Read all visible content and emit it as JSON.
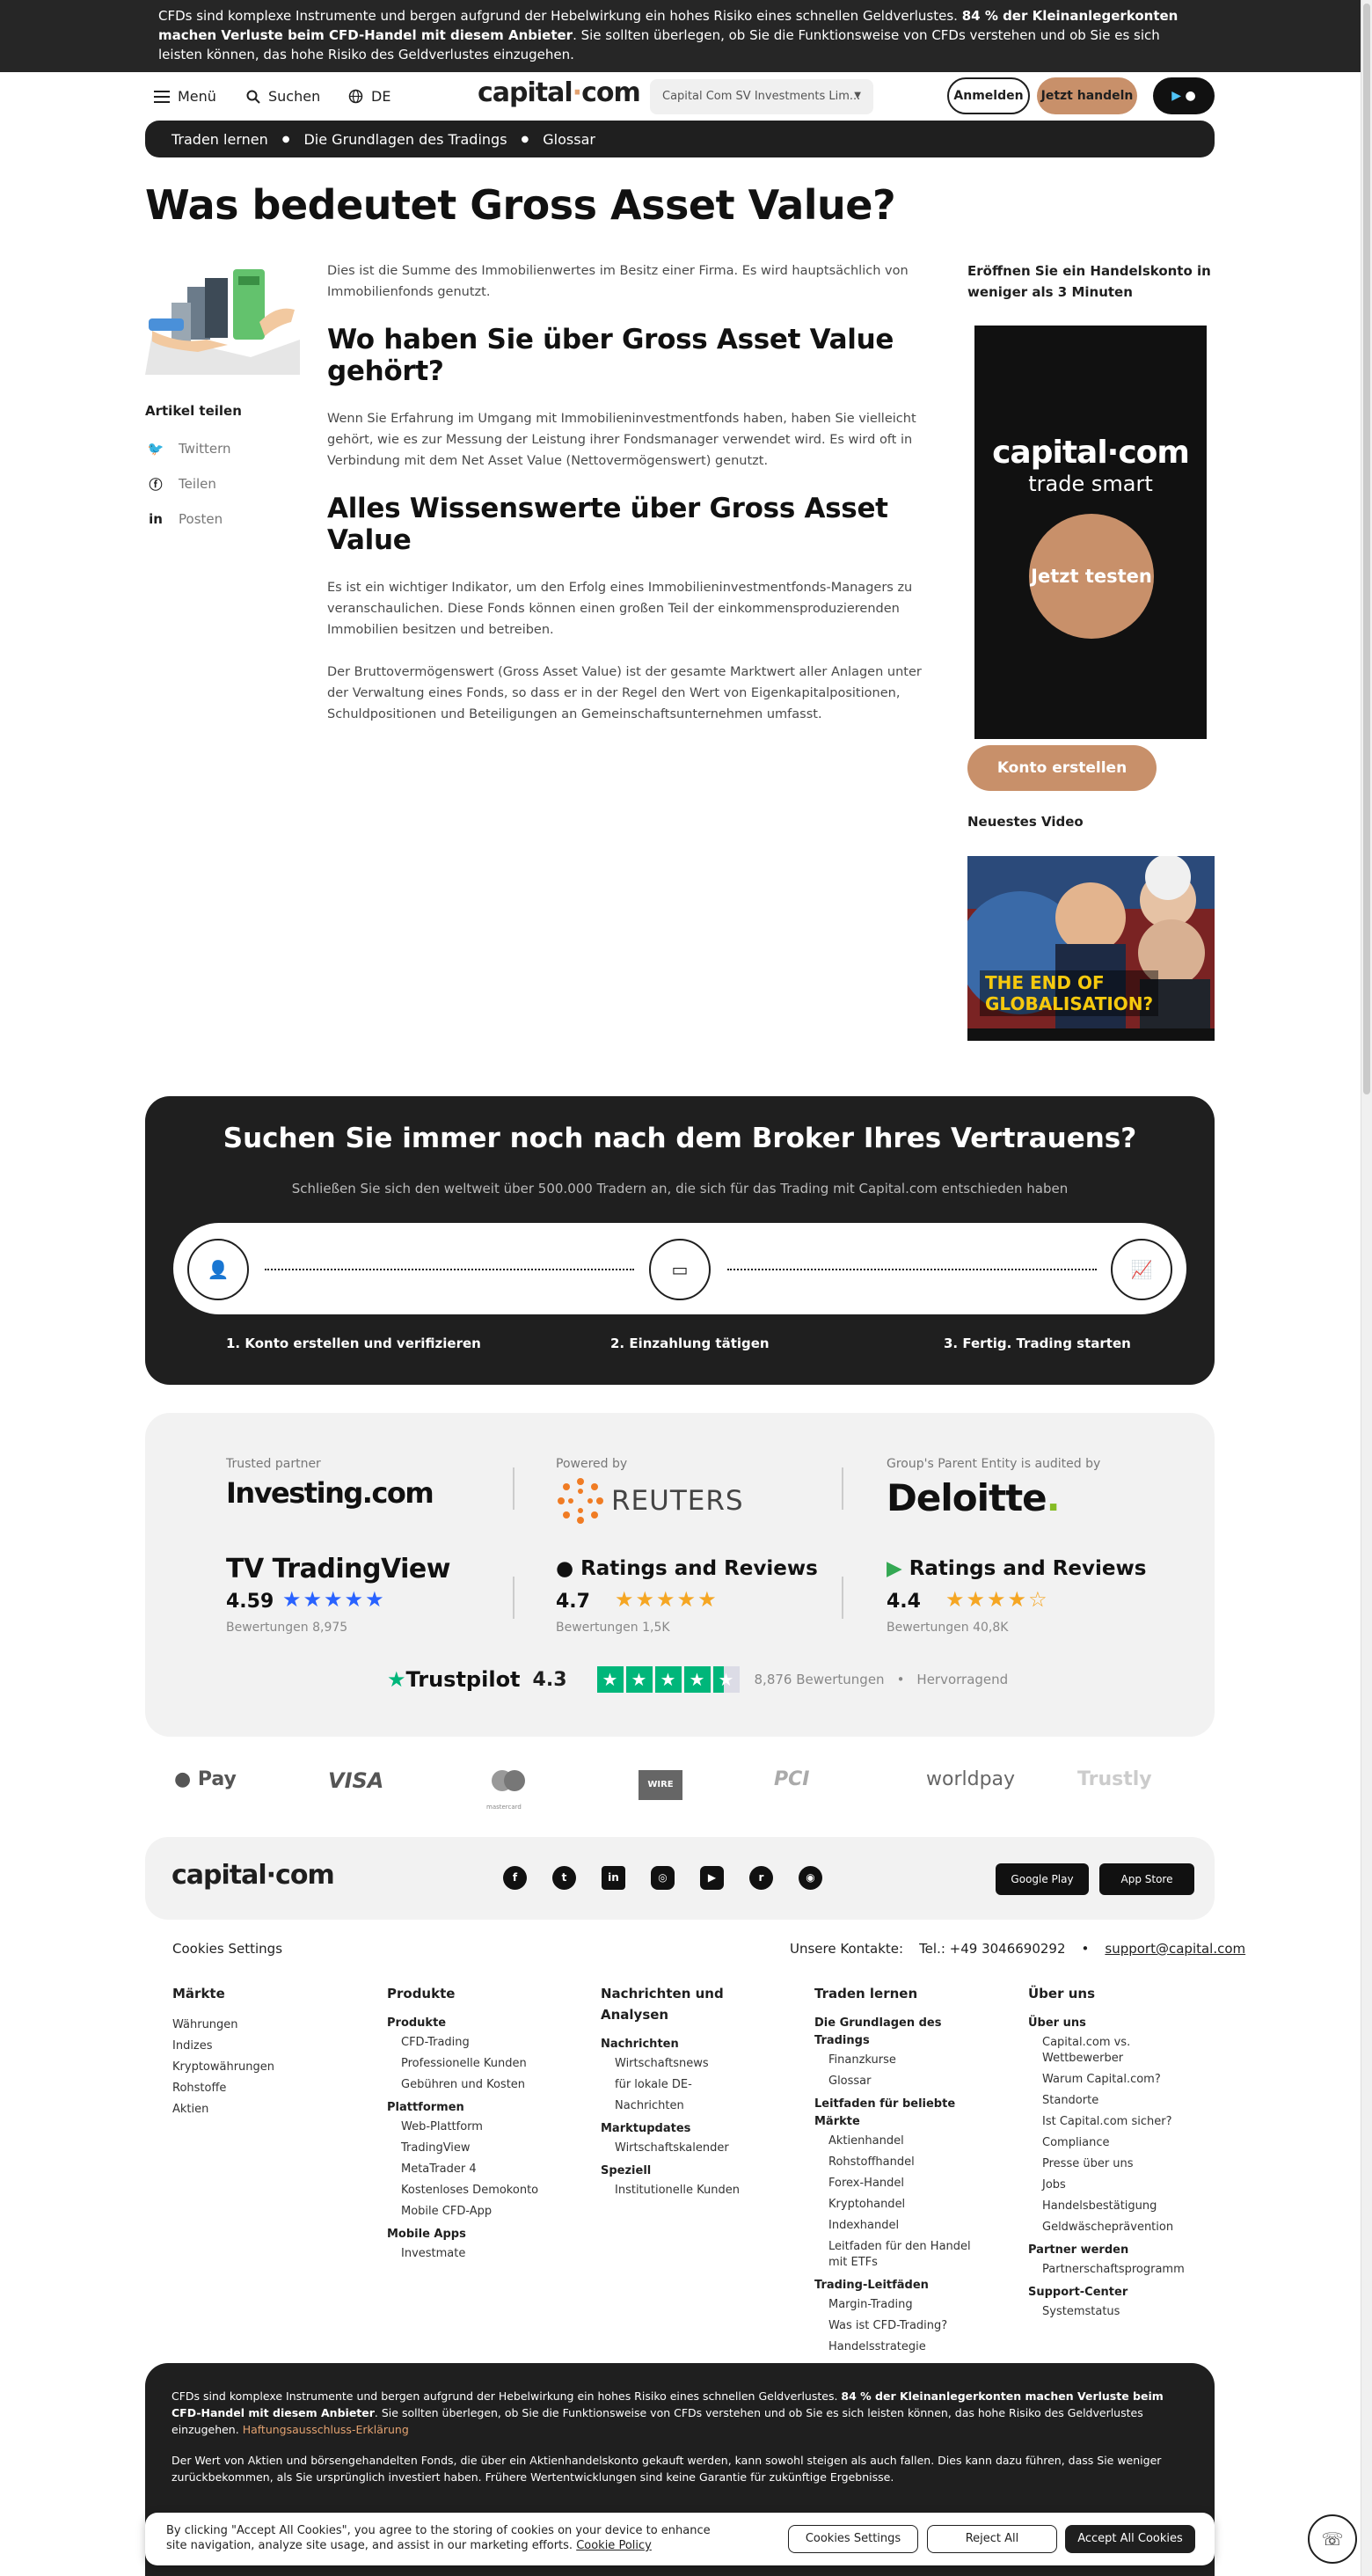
{
  "risk_banner": {
    "text_a": "CFDs sind komplexe Instrumente und bergen aufgrund der Hebelwirkung ein hohes Risiko eines schnellen Geldverlustes. ",
    "text_bold": "84 % der Kleinanlegerkonten machen Verluste beim CFD-Handel mit diesem Anbieter",
    "text_b": ". Sie sollten überlegen, ob Sie die Funktionsweise von CFDs verstehen und ob Sie es sich leisten können, das hohe Risiko des Geldverlustes einzugehen."
  },
  "header": {
    "menu": "Menü",
    "search": "Suchen",
    "lang": "DE",
    "logo": "capital",
    "logo_dot": "·",
    "logo_end": "com",
    "entity": "Capital Com SV Investments Lim...",
    "login": "Anmelden",
    "trade": "Jetzt handeln"
  },
  "breadcrumb": [
    "Traden lernen",
    "Die Grundlagen des Tradings",
    "Glossar"
  ],
  "page_title": "Was bedeutet Gross Asset Value?",
  "share": {
    "title": "Artikel teilen",
    "items": [
      "Twittern",
      "Teilen",
      "Posten"
    ]
  },
  "article": {
    "p1": "Dies ist die Summe des Immobilienwertes im Besitz einer Firma. Es wird hauptsächlich von Immobilienfonds genutzt.",
    "h2a": "Wo haben Sie über Gross Asset Value gehört?",
    "p2": "Wenn Sie Erfahrung im Umgang mit Immobilieninvestmentfonds haben, haben Sie vielleicht gehört, wie es zur Messung der Leistung ihrer Fondsmanager verwendet wird. Es wird oft in Verbindung mit dem Net Asset Value (Nettovermögenswert) genutzt.",
    "h2b": "Alles Wissenswerte über Gross Asset Value",
    "p3": "Es ist ein wichtiger Indikator, um den Erfolg eines Immobilieninvestmentfonds-Managers zu veranschaulichen. Diese Fonds können einen großen Teil der einkommensproduzierenden Immobilien besitzen und betreiben.",
    "p4": "Der Bruttovermögenswert (Gross Asset Value) ist der gesamte Marktwert aller Anlagen unter der Verwaltung eines Fonds, so dass er in der Regel den Wert von Eigenkapitalpositionen, Schuldpositionen und Beteiligungen an Gemeinschaftsunternehmen umfasst."
  },
  "sidebar": {
    "promo": "Eröffnen Sie ein Handelskonto in weniger als 3 Minuten",
    "ad_logo": "capital·com",
    "ad_tagline": "trade smart",
    "ad_cta": "Jetzt testen",
    "konto": "Konto erstellen",
    "video_title": "Neuestes Video",
    "video_caption_1": "THE END OF",
    "video_caption_2": "GLOBALISATION?"
  },
  "broker": {
    "title": "Suchen Sie immer noch nach dem Broker Ihres Vertrauens?",
    "subtitle": "Schließen Sie sich den weltweit über 500.000 Tradern an, die sich für das Trading mit Capital.com entschieden haben",
    "steps": [
      "1. Konto erstellen und verifizieren",
      "2. Einzahlung tätigen",
      "3. Fertig. Trading starten"
    ]
  },
  "trust": {
    "partner_cap": "Trusted partner",
    "partner": "Investing.com",
    "powered_cap": "Powered by",
    "powered": "REUTERS",
    "audit_cap": "Group's Parent Entity is audited by",
    "audit": "Deloitte",
    "tv_name": "TradingView",
    "tv_score": "4.59",
    "tv_count": "Bewertungen 8,975",
    "apple_name": "Ratings and Reviews",
    "apple_score": "4.7",
    "apple_count": "Bewertungen 1,5K",
    "google_name": "Ratings and Reviews",
    "google_score": "4.4",
    "google_count": "Bewertungen 40,8K",
    "tp_name": "Trustpilot",
    "tp_score": "4.3",
    "tp_count": "8,876 Bewertungen",
    "tp_label": "Hervorragend"
  },
  "payments": [
    "Pay",
    "VISA",
    "mastercard",
    "WIRE",
    "PCI",
    "worldpay",
    "Trustly"
  ],
  "footer": {
    "logo": "capital·com",
    "google_play": "Google Play",
    "app_store": "App Store",
    "cookie_settings": "Cookies Settings",
    "contacts_label": "Unsere Kontakte:",
    "phone": "Tel.: +49 3046690292",
    "email": "support@capital.com",
    "cols": {
      "maerkte": {
        "title": "Märkte",
        "items": [
          "Währungen",
          "Indizes",
          "Kryptowährungen",
          "Rohstoffe",
          "Aktien"
        ]
      },
      "produkte": {
        "title": "Produkte",
        "g1": "Produkte",
        "g1_items": [
          "CFD-Trading",
          "Professionelle Kunden",
          "Gebühren und Kosten"
        ],
        "g2": "Plattformen",
        "g2_items": [
          "Web-Plattform",
          "TradingView",
          "MetaTrader 4",
          "Kostenloses Demokonto",
          "Mobile CFD-App"
        ],
        "g3": "Mobile Apps",
        "g3_items": [
          "Investmate"
        ]
      },
      "news": {
        "title": "Nachrichten und Analysen",
        "g1": "Nachrichten",
        "g1_items": [
          "Wirtschaftsnews",
          "für lokale DE-Nachrichten"
        ],
        "g2": "Marktupdates",
        "g2_items": [
          "Wirtschaftskalender"
        ],
        "g3": "Speziell",
        "g3_items": [
          "Institutionelle Kunden"
        ]
      },
      "lernen": {
        "title": "Traden lernen",
        "g1": "Die Grundlagen des Tradings",
        "g1_items": [
          "Finanzkurse",
          "Glossar"
        ],
        "g2": "Leitfaden für beliebte Märkte",
        "g2_items": [
          "Aktienhandel",
          "Rohstoffhandel",
          "Forex-Handel",
          "Kryptohandel",
          "Indexhandel",
          "Leitfaden für den Handel mit ETFs"
        ],
        "g3": "Trading-Leitfäden",
        "g3_items": [
          "Margin-Trading",
          "Was ist CFD-Trading?",
          "Handelsstrategie"
        ]
      },
      "ueber": {
        "title": "Über uns",
        "g1": "Über uns",
        "g1_items": [
          "Capital.com vs. Wettbewerber",
          "Warum Capital.com?",
          "Standorte",
          "Ist Capital.com sicher?",
          "Compliance",
          "Presse über uns",
          "Jobs",
          "Handelsbestätigung",
          "Geldwäscheprävention"
        ],
        "g2": "Partner werden",
        "g2_items": [
          "Partnerschaftsprogramm"
        ],
        "g3": "Support-Center",
        "g3_items": [
          "Systemstatus"
        ]
      }
    }
  },
  "disclaimer": {
    "p1a": "CFDs sind komplexe Instrumente und bergen aufgrund der Hebelwirkung ein hohes Risiko eines schnellen Geldverlustes. ",
    "p1b": "84 % der Kleinanlegerkonten machen Verluste beim CFD-Handel mit diesem Anbieter",
    "p1c": ". Sie sollten überlegen, ob Sie die Funktionsweise von CFDs verstehen und ob Sie es sich leisten können, das hohe Risiko des Geldverlustes einzugehen. ",
    "p1link": "Haftungsausschluss-Erklärung",
    "p2": "Der Wert von Aktien und börsengehandelten Fonds, die über ein Aktienhandelskonto gekauft werden, kann sowohl steigen als auch fallen. Dies kann dazu führen, dass Sie weniger zurückbekommen, als Sie ursprünglich investiert haben. Frühere Wertentwicklungen sind keine Garantie für zukünftige Ergebnisse."
  },
  "cookie_banner": {
    "text": "By clicking \"Accept All Cookies\", you agree to the storing of cookies on your device to enhance site navigation, analyze site usage, and assist in our marketing efforts.",
    "policy": "Cookie Policy",
    "settings": "Cookies Settings",
    "reject": "Reject All",
    "accept": "Accept All Cookies"
  },
  "colors": {
    "accent": "#c8906a",
    "dark": "#1f1f1f",
    "trustpilot": "#00b67a"
  }
}
